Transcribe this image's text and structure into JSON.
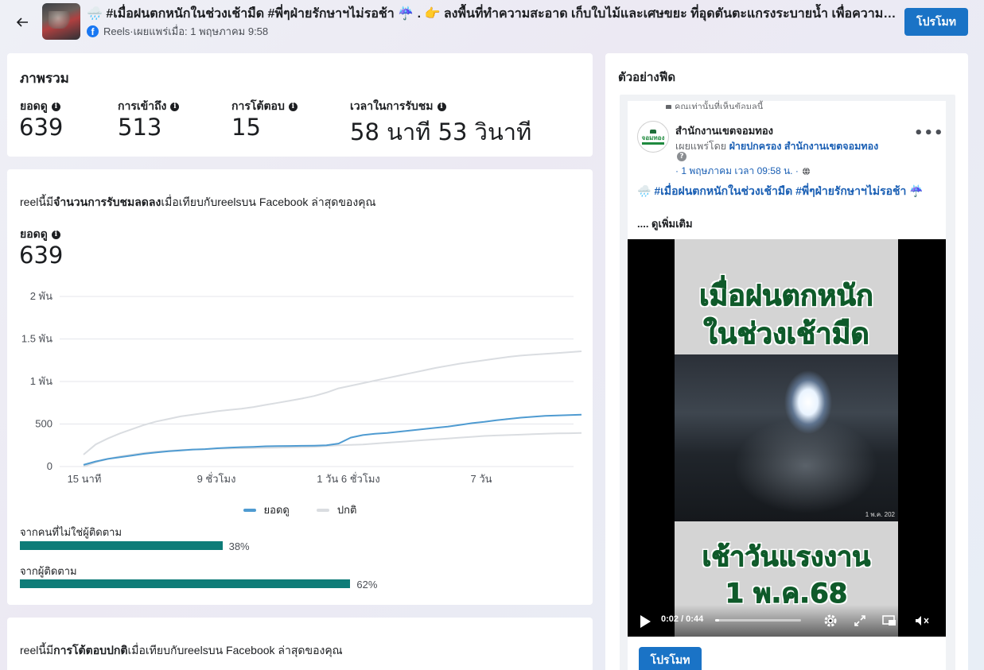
{
  "header": {
    "title": "🌧️ #เมื่อฝนตกหนักในช่วงเช้ามืด #พี่ๆฝ่ายรักษาฯไม่รอช้า ☔ . 👉 ลงพื้นที่ทำความสะอาด เก็บใบไม้และเศษขยะ ที่อุดตันตะแกรงระบายน้ำ เพื่อความปลอดภัย",
    "platform": "Reels",
    "separator": " · ",
    "published": "เผยแพร่เมื่อ: 1 พฤษภาคม 9:58",
    "promote_label": "โปรโมท"
  },
  "overview": {
    "title": "ภาพรวม",
    "metrics": [
      {
        "label": "ยอดดู",
        "value": "639"
      },
      {
        "label": "การเข้าถึง",
        "value": "513"
      },
      {
        "label": "การโต้ตอบ",
        "value": "15"
      },
      {
        "label": "เวลาในการรับชม",
        "value": "58 นาที 53 วินาที"
      }
    ]
  },
  "views": {
    "notice_prefix": "reelนี้มี",
    "notice_bold": "จำนวนการรับชมลดลง",
    "notice_suffix": "เมื่อเทียบกับreelsบน Facebook ล่าสุดของคุณ",
    "label": "ยอดดู",
    "value": "639",
    "bars": [
      {
        "label": "จากคนที่ไม่ใช่ผู้ติดตาม",
        "percent": 38,
        "percent_text": "38%"
      },
      {
        "label": "จากผู้ติดตาม",
        "percent": 62,
        "percent_text": "62%"
      }
    ]
  },
  "interaction": {
    "notice_prefix": "reelนี้มี",
    "notice_bold": "การโต้ตอบปกติ",
    "notice_suffix": "เมื่อเทียบกับreelsบน Facebook ล่าสุดของคุณ"
  },
  "preview": {
    "title": "ตัวอย่างฟีด",
    "top_note": "คุณเท่านั้นที่เห็นข้อมูลนี้",
    "avatar_text": "จอมทอง",
    "page_name": "สำนักงานเขตจอมทอง",
    "published_by_prefix": "เผยแพร่โดย ",
    "published_by_link": "ฝ่ายปกครอง สำนักงานเขตจอมทอง",
    "date": "· 1 พฤษภาคม เวลา 09:58 น. ·",
    "post_text": "🌧️ #เมื่อฝนตกหนักในช่วงเช้ามืด #พี่ๆฝ่ายรักษาฯไม่รอช้า ☔",
    "see_more": ".... ดูเพิ่มเติม",
    "video_headline_top_1": "เมื่อฝนตกหนัก",
    "video_headline_top_2": "ในช่วงเช้ามืด",
    "video_headline_bottom_1": "เช้าวันแรงงาน",
    "video_headline_bottom_2": "1 พ.ค.68",
    "video_stamp": "1 พ.ค. 202",
    "time_text": "0:02 / 0:44",
    "progress": 0.045,
    "promote_label": "โปรโมท"
  },
  "colors": {
    "views_line": "#4f9bd1",
    "normal_line": "#dadde1",
    "bar_fill": "#0e7c78",
    "primary_button": "#1a73c6"
  },
  "chart_data": {
    "type": "line",
    "x_ticks": [
      "15 นาที",
      "9 ชั่วโมง",
      "1 วัน 6 ชั่วโมง",
      "7 วัน"
    ],
    "y_ticks": [
      "0",
      "500",
      "1 พัน",
      "1.5 พัน",
      "2 พัน"
    ],
    "ylim": [
      0,
      2000
    ],
    "series": [
      {
        "name": "ยอดดู",
        "color": "#4f9bd1",
        "values": [
          20,
          60,
          90,
          110,
          130,
          150,
          165,
          180,
          190,
          200,
          205,
          215,
          222,
          228,
          232,
          238,
          240,
          242,
          244,
          246,
          250,
          270,
          340,
          370,
          385,
          395,
          410,
          425,
          440,
          455,
          470,
          490,
          510,
          525,
          545,
          560,
          575,
          585,
          595,
          600,
          605,
          610
        ]
      },
      {
        "name": "ปกติ",
        "color": "#dadde1",
        "values": [
          140,
          260,
          330,
          390,
          440,
          490,
          530,
          560,
          590,
          610,
          630,
          650,
          665,
          680,
          700,
          725,
          750,
          775,
          800,
          830,
          870,
          920,
          950,
          980,
          1010,
          1040,
          1070,
          1100,
          1130,
          1160,
          1185,
          1210,
          1230,
          1250,
          1270,
          1290,
          1305,
          1315,
          1325,
          1335,
          1345,
          1355
        ]
      },
      {
        "name": "",
        "color": "#dadde1",
        "values": [
          0,
          50,
          90,
          120,
          140,
          160,
          175,
          185,
          195,
          200,
          205,
          210,
          212,
          215,
          218,
          220,
          222,
          225,
          228,
          232,
          240,
          250,
          255,
          260,
          270,
          280,
          290,
          300,
          310,
          320,
          330,
          340,
          350,
          360,
          365,
          370,
          375,
          380,
          385,
          390,
          392,
          395
        ]
      }
    ],
    "legend": [
      "ยอดดู",
      "ปกติ"
    ],
    "legend_position": "bottom",
    "grid": true
  }
}
